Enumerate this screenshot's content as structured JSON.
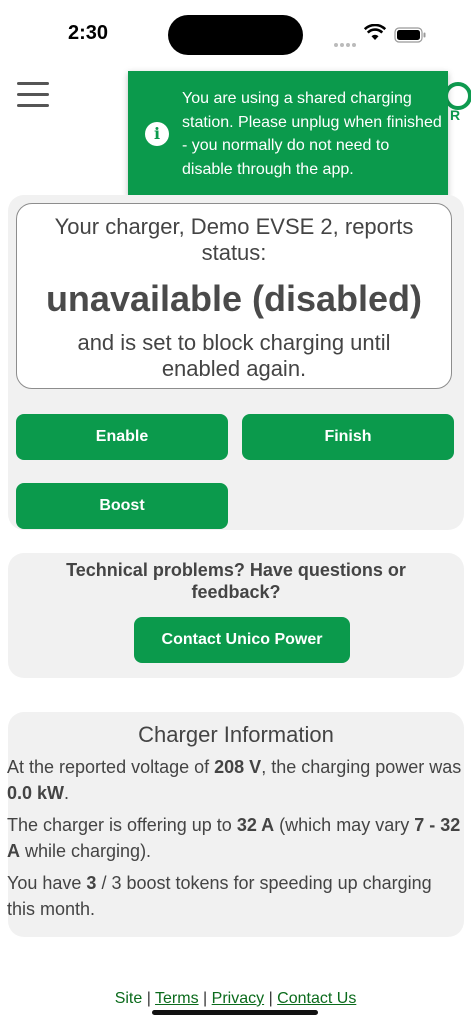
{
  "status_bar": {
    "time": "2:30"
  },
  "toast": {
    "message": "You are using a shared charging station. Please unplug when finished - you normally do not need to disable through the app.",
    "icon": "info-icon"
  },
  "charger_status": {
    "intro": "Your charger, Demo EVSE 2, reports status:",
    "status": "unavailable (disabled)",
    "detail": "and is set to block charging until enabled again."
  },
  "actions": {
    "enable_label": "Enable",
    "finish_label": "Finish",
    "boost_label": "Boost"
  },
  "help": {
    "text": "Technical problems? Have questions or feedback?",
    "contact_label": "Contact Unico Power"
  },
  "info": {
    "title": "Charger Information",
    "voltage_pre": "At the reported voltage of ",
    "voltage": "208 V",
    "voltage_mid": ", the charging power was ",
    "power": "0.0 kW",
    "voltage_post": ".",
    "current_pre": "The charger is offering up to ",
    "current": "32 A",
    "current_mid": " (which may vary ",
    "current_range": "7 - 32 A",
    "current_post": " while charging).",
    "tokens_pre": "You have ",
    "tokens_used": "3",
    "tokens_mid": " / 3 boost tokens for speeding up charging this month."
  },
  "footer": {
    "site": "Site",
    "terms": "Terms",
    "privacy": "Privacy",
    "contact": "Contact Us",
    "sep": "|"
  },
  "colors": {
    "accent": "#0b9a4c",
    "card_bg": "#f1f1f1"
  }
}
